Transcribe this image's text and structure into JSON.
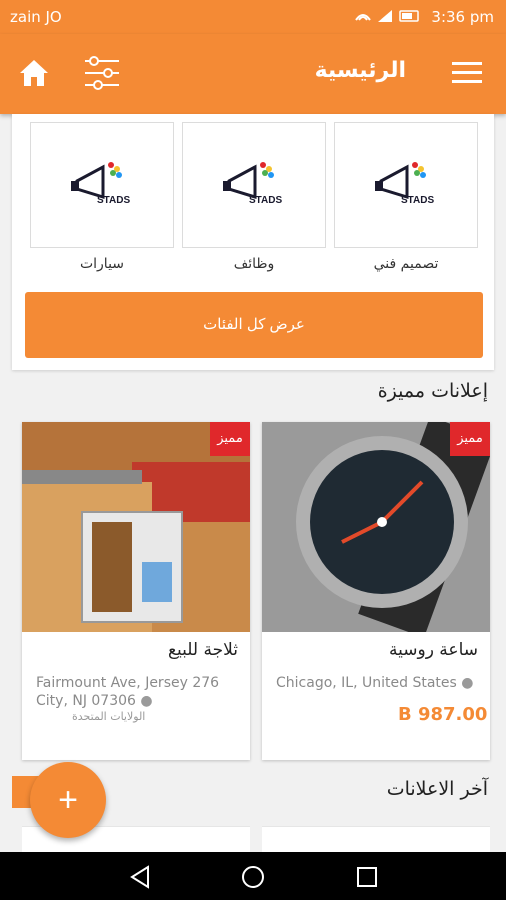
{
  "status_bar": {
    "carrier": "zain JO",
    "time": "3:36 pm"
  },
  "app_bar": {
    "title": "الرئيسية"
  },
  "categories": {
    "items": [
      {
        "label": "سيارات",
        "logo_text": "STADS"
      },
      {
        "label": "وظائف",
        "logo_text": "STADS"
      },
      {
        "label": "تصميم فني",
        "logo_text": "STADS"
      }
    ],
    "all_button": "عرض كل الفئات"
  },
  "featured": {
    "title": "إعلانات مميزة",
    "badge": "مميز",
    "ads": [
      {
        "title": "ثلاجة للبيع",
        "location": "Fairmount Ave, Jersey 276 City, NJ 07306",
        "location_suffix": "الولايات المتحدة",
        "price": ""
      },
      {
        "title": "ساعة روسية",
        "location": "Chicago, IL, United States",
        "price": "B 987.00"
      }
    ]
  },
  "latest": {
    "title": "آخر الاعلانات"
  },
  "fab": {
    "label": "+"
  },
  "colors": {
    "primary": "#f48a35",
    "badge": "#e0282b"
  }
}
